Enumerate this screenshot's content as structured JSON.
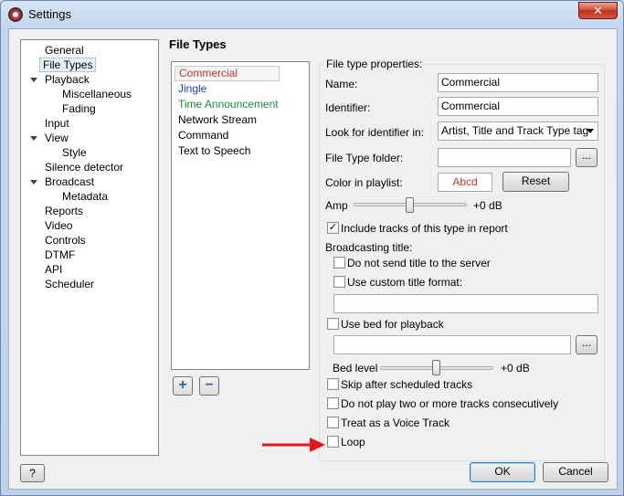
{
  "window": {
    "title": "Settings",
    "close_label": "✕"
  },
  "tree": {
    "items": [
      {
        "label": "General",
        "level": 0
      },
      {
        "label": "File Types",
        "level": 0,
        "selected": true
      },
      {
        "label": "Playback",
        "level": 0,
        "expanded": true
      },
      {
        "label": "Miscellaneous",
        "level": 1
      },
      {
        "label": "Fading",
        "level": 1
      },
      {
        "label": "Input",
        "level": 0
      },
      {
        "label": "View",
        "level": 0,
        "expanded": true
      },
      {
        "label": "Style",
        "level": 1
      },
      {
        "label": "Silence detector",
        "level": 0
      },
      {
        "label": "Broadcast",
        "level": 0,
        "expanded": true
      },
      {
        "label": "Metadata",
        "level": 1
      },
      {
        "label": "Reports",
        "level": 0
      },
      {
        "label": "Video",
        "level": 0
      },
      {
        "label": "Controls",
        "level": 0
      },
      {
        "label": "DTMF",
        "level": 0
      },
      {
        "label": "API",
        "level": 0
      },
      {
        "label": "Scheduler",
        "level": 0
      }
    ]
  },
  "page": {
    "heading": "File Types"
  },
  "file_types": {
    "items": [
      {
        "label": "Commercial",
        "color": "#c0392b",
        "selected": true
      },
      {
        "label": "Jingle",
        "color": "#1c3fbf"
      },
      {
        "label": "Time Announcement",
        "color": "#1e8a3a"
      },
      {
        "label": "Network Stream",
        "color": "#000000"
      },
      {
        "label": "Command",
        "color": "#000000"
      },
      {
        "label": "Text to Speech",
        "color": "#000000"
      }
    ],
    "add_label": "+",
    "remove_label": "−"
  },
  "properties": {
    "group_title": "File type properties:",
    "name_label": "Name:",
    "name_value": "Commercial",
    "identifier_label": "Identifier:",
    "identifier_value": "Commercial",
    "look_label": "Look for identifier in:",
    "look_value": "Artist, Title and Track Type tag",
    "folder_label": "File Type folder:",
    "folder_value": "",
    "browse_label": "...",
    "color_label": "Color in playlist:",
    "color_sample": "Abcd",
    "reset_label": "Reset",
    "amp_label": "Amp",
    "amp_value_label": "+0 dB",
    "amp_level": 0.5,
    "include_label": "Include tracks of this type in report",
    "include_checked": true,
    "broadcasting_title_label": "Broadcasting title:",
    "no_send_label": "Do not send title to the server",
    "no_send_checked": false,
    "custom_format_label": "Use custom title format:",
    "custom_format_checked": false,
    "custom_format_value": "",
    "use_bed_label": "Use bed for playback",
    "use_bed_checked": false,
    "bed_value": "",
    "bed_browse_label": "...",
    "bed_level_label": "Bed level",
    "bed_level_value_label": "+0 dB",
    "bed_level": 0.5,
    "skip_label": "Skip after scheduled tracks",
    "skip_checked": false,
    "no_consecutive_label": "Do not play two or more tracks consecutively",
    "no_consecutive_checked": false,
    "voice_track_label": "Treat as a Voice Track",
    "voice_track_checked": false,
    "loop_label": "Loop",
    "loop_checked": false
  },
  "footer": {
    "help_label": "?",
    "ok_label": "OK",
    "cancel_label": "Cancel"
  },
  "colors": {
    "annotation_arrow": "#e8161b",
    "accent": "#2a64b5"
  }
}
